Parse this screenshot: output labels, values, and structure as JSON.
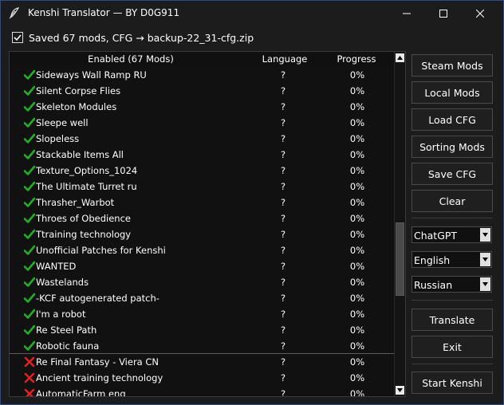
{
  "window": {
    "title": "Kenshi Translator — BY D0G911"
  },
  "status": {
    "checked": true,
    "text": "Saved 67 mods, CFG → backup-22_31-cfg.zip"
  },
  "table": {
    "columns": [
      "Enabled (67 Mods)",
      "Language",
      "Progress"
    ],
    "rows": [
      {
        "name": "Sideways Wall Ramp RU",
        "enabled": true,
        "language": "?",
        "progress": "0%"
      },
      {
        "name": "Silent Corpse Flies",
        "enabled": true,
        "language": "?",
        "progress": "0%"
      },
      {
        "name": "Skeleton Modules",
        "enabled": true,
        "language": "?",
        "progress": "0%"
      },
      {
        "name": "Sleepe well",
        "enabled": true,
        "language": "?",
        "progress": "0%"
      },
      {
        "name": "Slopeless",
        "enabled": true,
        "language": "?",
        "progress": "0%"
      },
      {
        "name": "Stackable Items All",
        "enabled": true,
        "language": "?",
        "progress": "0%"
      },
      {
        "name": "Texture_Options_1024",
        "enabled": true,
        "language": "?",
        "progress": "0%"
      },
      {
        "name": "The Ultimate Turret ru",
        "enabled": true,
        "language": "?",
        "progress": "0%"
      },
      {
        "name": "Thrasher_Warbot",
        "enabled": true,
        "language": "?",
        "progress": "0%"
      },
      {
        "name": "Throes of Obedience",
        "enabled": true,
        "language": "?",
        "progress": "0%"
      },
      {
        "name": "Ttraining technology",
        "enabled": true,
        "language": "?",
        "progress": "0%"
      },
      {
        "name": "Unofficial Patches for Kenshi",
        "enabled": true,
        "language": "?",
        "progress": "0%"
      },
      {
        "name": "WANTED",
        "enabled": true,
        "language": "?",
        "progress": "0%"
      },
      {
        "name": "Wastelands",
        "enabled": true,
        "language": "?",
        "progress": "0%"
      },
      {
        "name": "-KCF autogenerated patch-",
        "enabled": true,
        "language": "?",
        "progress": "0%"
      },
      {
        "name": "I'm a robot",
        "enabled": true,
        "language": "?",
        "progress": "0%"
      },
      {
        "name": "Re Steel Path",
        "enabled": true,
        "language": "?",
        "progress": "0%"
      },
      {
        "name": "Robotic fauna",
        "enabled": true,
        "language": "?",
        "progress": "0%"
      },
      {
        "name": "Re Final Fantasy - Viera CN",
        "enabled": false,
        "language": "?",
        "progress": "0%"
      },
      {
        "name": "Ancient training technology",
        "enabled": false,
        "language": "?",
        "progress": "0%"
      },
      {
        "name": "AutomaticFarm eng",
        "enabled": false,
        "language": "?",
        "progress": "0%"
      }
    ]
  },
  "sidebar": {
    "buttons": [
      "Steam Mods",
      "Local Mods",
      "Load CFG",
      "Sorting Mods",
      "Save CFG",
      "Clear"
    ],
    "translator_select": "ChatGPT",
    "source_language_select": "English",
    "target_language_select": "Russian",
    "translate_label": "Translate",
    "exit_label": "Exit",
    "start_label": "Start Kenshi"
  },
  "colors": {
    "check_green": "#22b022",
    "cross_red": "#e02020",
    "window_border": "#2b4a8f"
  }
}
